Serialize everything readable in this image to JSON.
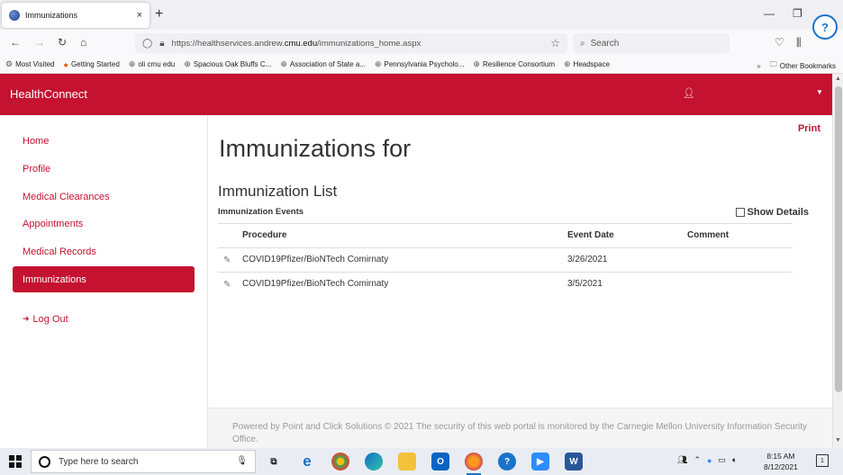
{
  "browser": {
    "tab_title": "Immunizations",
    "tab_close": "×",
    "new_tab": "+",
    "url_prefix": "https://healthservices.andrew.",
    "url_domain": "cmu.edu",
    "url_suffix": "/immunizations_home.aspx",
    "search_placeholder": "Search",
    "bookmarks": [
      {
        "label": "Most Visited",
        "icon": "gear-icon"
      },
      {
        "label": "Getting Started",
        "icon": "firefox-icon"
      },
      {
        "label": "oli cmu edu",
        "icon": "globe-icon"
      },
      {
        "label": "Spacious Oak Bluffs C...",
        "icon": "globe-icon"
      },
      {
        "label": "Association of State a...",
        "icon": "globe-icon"
      },
      {
        "label": "Pennsylvania Psycholo...",
        "icon": "globe-icon"
      },
      {
        "label": "Resilience Consortium",
        "icon": "globe-icon"
      },
      {
        "label": "Headspace",
        "icon": "globe-icon"
      }
    ],
    "other_bookmarks": "Other Bookmarks"
  },
  "app": {
    "brand": "HealthConnect",
    "accent_color": "#c41230"
  },
  "sidebar": {
    "items": [
      {
        "label": "Home"
      },
      {
        "label": "Profile"
      },
      {
        "label": "Medical Clearances"
      },
      {
        "label": "Appointments"
      },
      {
        "label": "Medical Records"
      },
      {
        "label": "Immunizations"
      }
    ],
    "logout": "Log Out"
  },
  "main": {
    "print": "Print",
    "title": "Immunizations for",
    "section_title": "Immunization List",
    "events_label": "Immunization Events",
    "show_details": "Show Details",
    "table": {
      "headers": [
        "Procedure",
        "Event Date",
        "Comment"
      ],
      "rows": [
        {
          "procedure": "COVID19Pfizer/BioNTech Comirnaty",
          "date": "3/26/2021",
          "comment": ""
        },
        {
          "procedure": "COVID19Pfizer/BioNTech Comirnaty",
          "date": "3/5/2021",
          "comment": ""
        }
      ]
    },
    "footer": "Powered by Point and Click Solutions © 2021 The security of this web portal is monitored by the Carnegie Mellon University Information Security Office."
  },
  "taskbar": {
    "search_placeholder": "Type here to search",
    "time": "8:15 AM",
    "date": "8/12/2021",
    "notifications": "1"
  }
}
